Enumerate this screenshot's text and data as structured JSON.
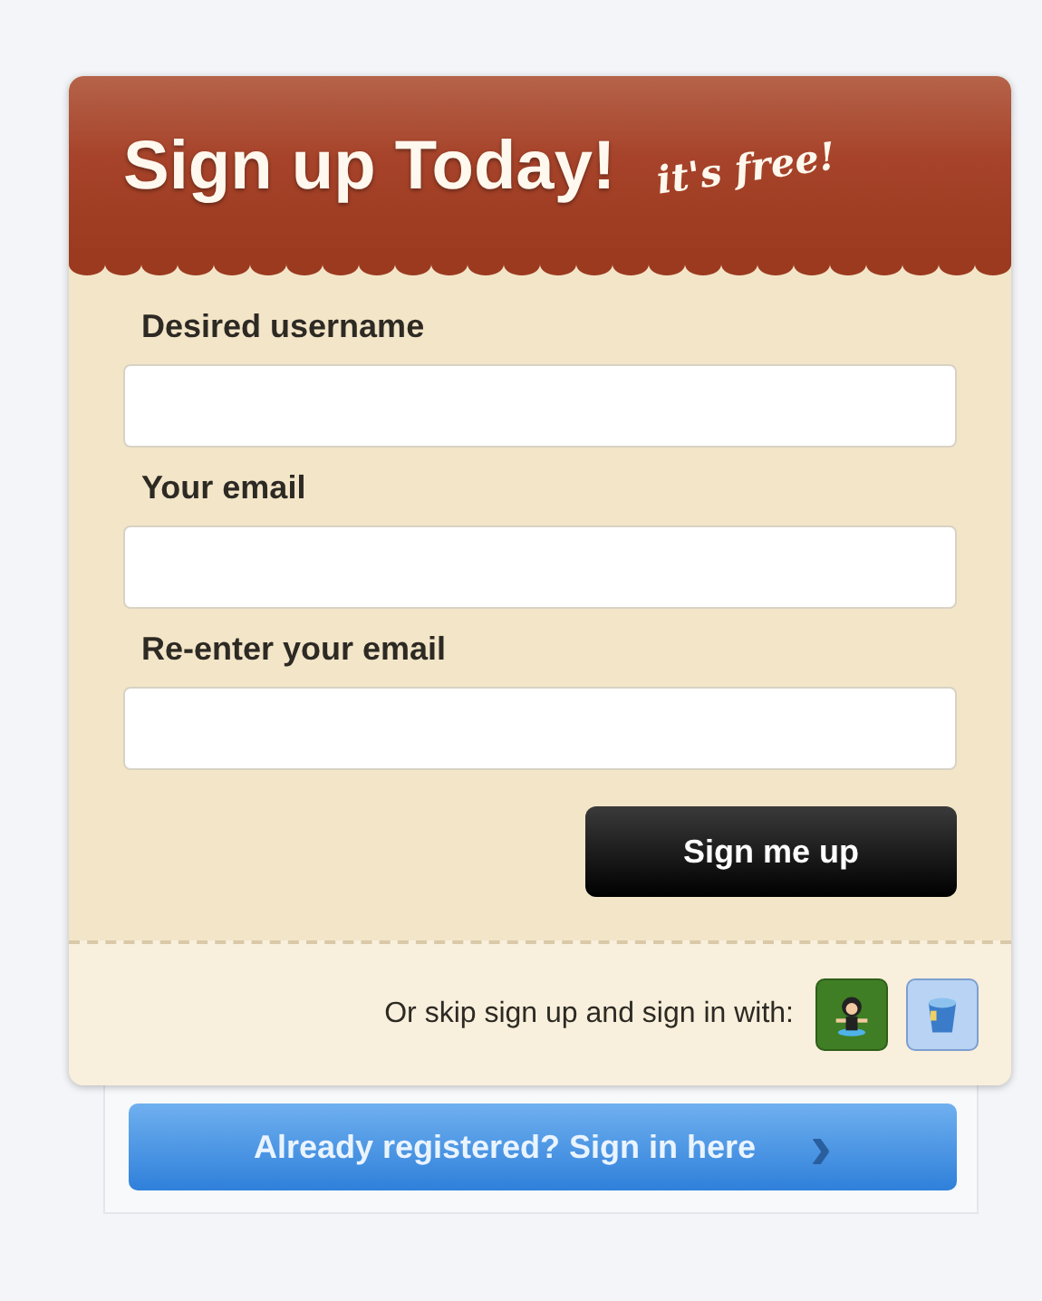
{
  "header": {
    "title": "Sign up Today!",
    "tagline": "it's free!"
  },
  "fields": [
    {
      "label": "Desired username"
    },
    {
      "label": "Your email"
    },
    {
      "label": "Re-enter your email"
    }
  ],
  "submit": "Sign me up",
  "footer": {
    "text": "Or skip sign up and sign in with:",
    "providers": [
      {
        "kind": "figure"
      },
      {
        "kind": "bucket"
      }
    ]
  },
  "signin": {
    "label": "Already registered? Sign in here",
    "arrow": "›"
  }
}
